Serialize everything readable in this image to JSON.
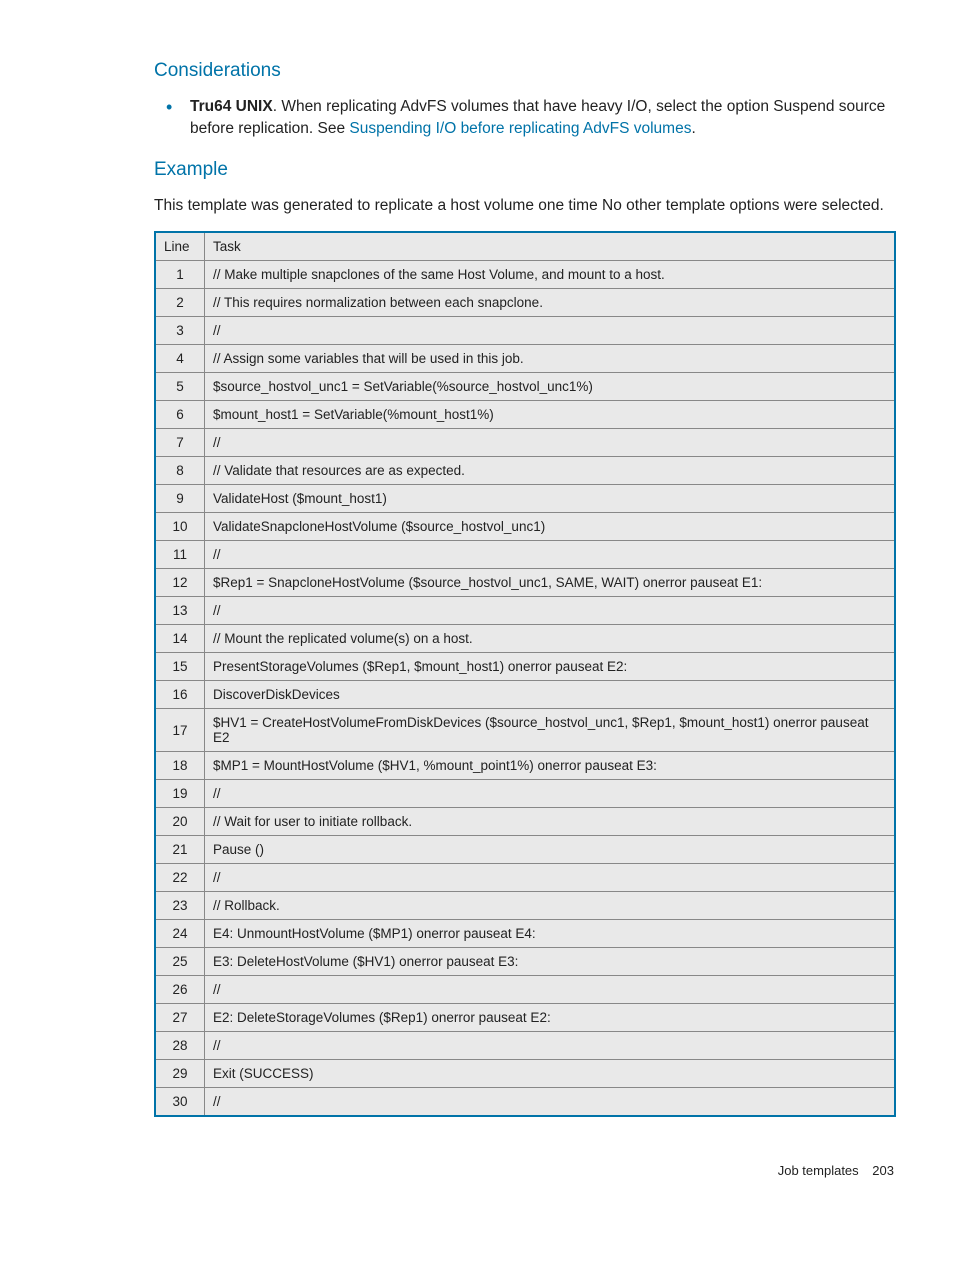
{
  "considerations": {
    "heading": "Considerations",
    "bullet_lead": "Tru64 UNIX",
    "bullet_text_before_link": ". When replicating AdvFS volumes that have heavy I/O, select the option Suspend source before replication. See ",
    "bullet_link_text": "Suspending I/O before replicating AdvFS volumes",
    "bullet_text_after_link": "."
  },
  "example": {
    "heading": "Example",
    "intro": "This template was generated to replicate a host volume one time No other template options were selected."
  },
  "table": {
    "col_line": "Line",
    "col_task": "Task",
    "rows": [
      {
        "n": "1",
        "t": "// Make multiple snapclones of the same Host Volume, and mount to a host."
      },
      {
        "n": "2",
        "t": "// This requires normalization between each snapclone."
      },
      {
        "n": "3",
        "t": "//"
      },
      {
        "n": "4",
        "t": "// Assign some variables that will be used in this job."
      },
      {
        "n": "5",
        "t": "$source_hostvol_unc1 = SetVariable(%source_hostvol_unc1%)"
      },
      {
        "n": "6",
        "t": "$mount_host1 = SetVariable(%mount_host1%)"
      },
      {
        "n": "7",
        "t": "//"
      },
      {
        "n": "8",
        "t": "// Validate that resources are as expected."
      },
      {
        "n": "9",
        "t": "ValidateHost ($mount_host1)"
      },
      {
        "n": "10",
        "t": "ValidateSnapcloneHostVolume ($source_hostvol_unc1)"
      },
      {
        "n": "11",
        "t": "//"
      },
      {
        "n": "12",
        "t": "$Rep1 = SnapcloneHostVolume ($source_hostvol_unc1, SAME, WAIT) onerror pauseat E1:"
      },
      {
        "n": "13",
        "t": "//"
      },
      {
        "n": "14",
        "t": "// Mount the replicated volume(s) on a host."
      },
      {
        "n": "15",
        "t": "PresentStorageVolumes ($Rep1, $mount_host1) onerror pauseat E2:"
      },
      {
        "n": "16",
        "t": "DiscoverDiskDevices"
      },
      {
        "n": "17",
        "t": "$HV1 = CreateHostVolumeFromDiskDevices ($source_hostvol_unc1, $Rep1, $mount_host1) onerror pauseat E2"
      },
      {
        "n": "18",
        "t": "$MP1 = MountHostVolume ($HV1, %mount_point1%) onerror pauseat E3:"
      },
      {
        "n": "19",
        "t": "//"
      },
      {
        "n": "20",
        "t": "// Wait for user to initiate rollback."
      },
      {
        "n": "21",
        "t": "Pause ()"
      },
      {
        "n": "22",
        "t": "//"
      },
      {
        "n": "23",
        "t": "// Rollback."
      },
      {
        "n": "24",
        "t": "E4: UnmountHostVolume ($MP1) onerror pauseat E4:"
      },
      {
        "n": "25",
        "t": "E3: DeleteHostVolume ($HV1) onerror pauseat E3:"
      },
      {
        "n": "26",
        "t": "//"
      },
      {
        "n": "27",
        "t": "E2: DeleteStorageVolumes ($Rep1) onerror pauseat E2:"
      },
      {
        "n": "28",
        "t": "//"
      },
      {
        "n": "29",
        "t": "Exit (SUCCESS)"
      },
      {
        "n": "30",
        "t": "//"
      }
    ]
  },
  "footer": {
    "section": "Job templates",
    "page": "203"
  }
}
